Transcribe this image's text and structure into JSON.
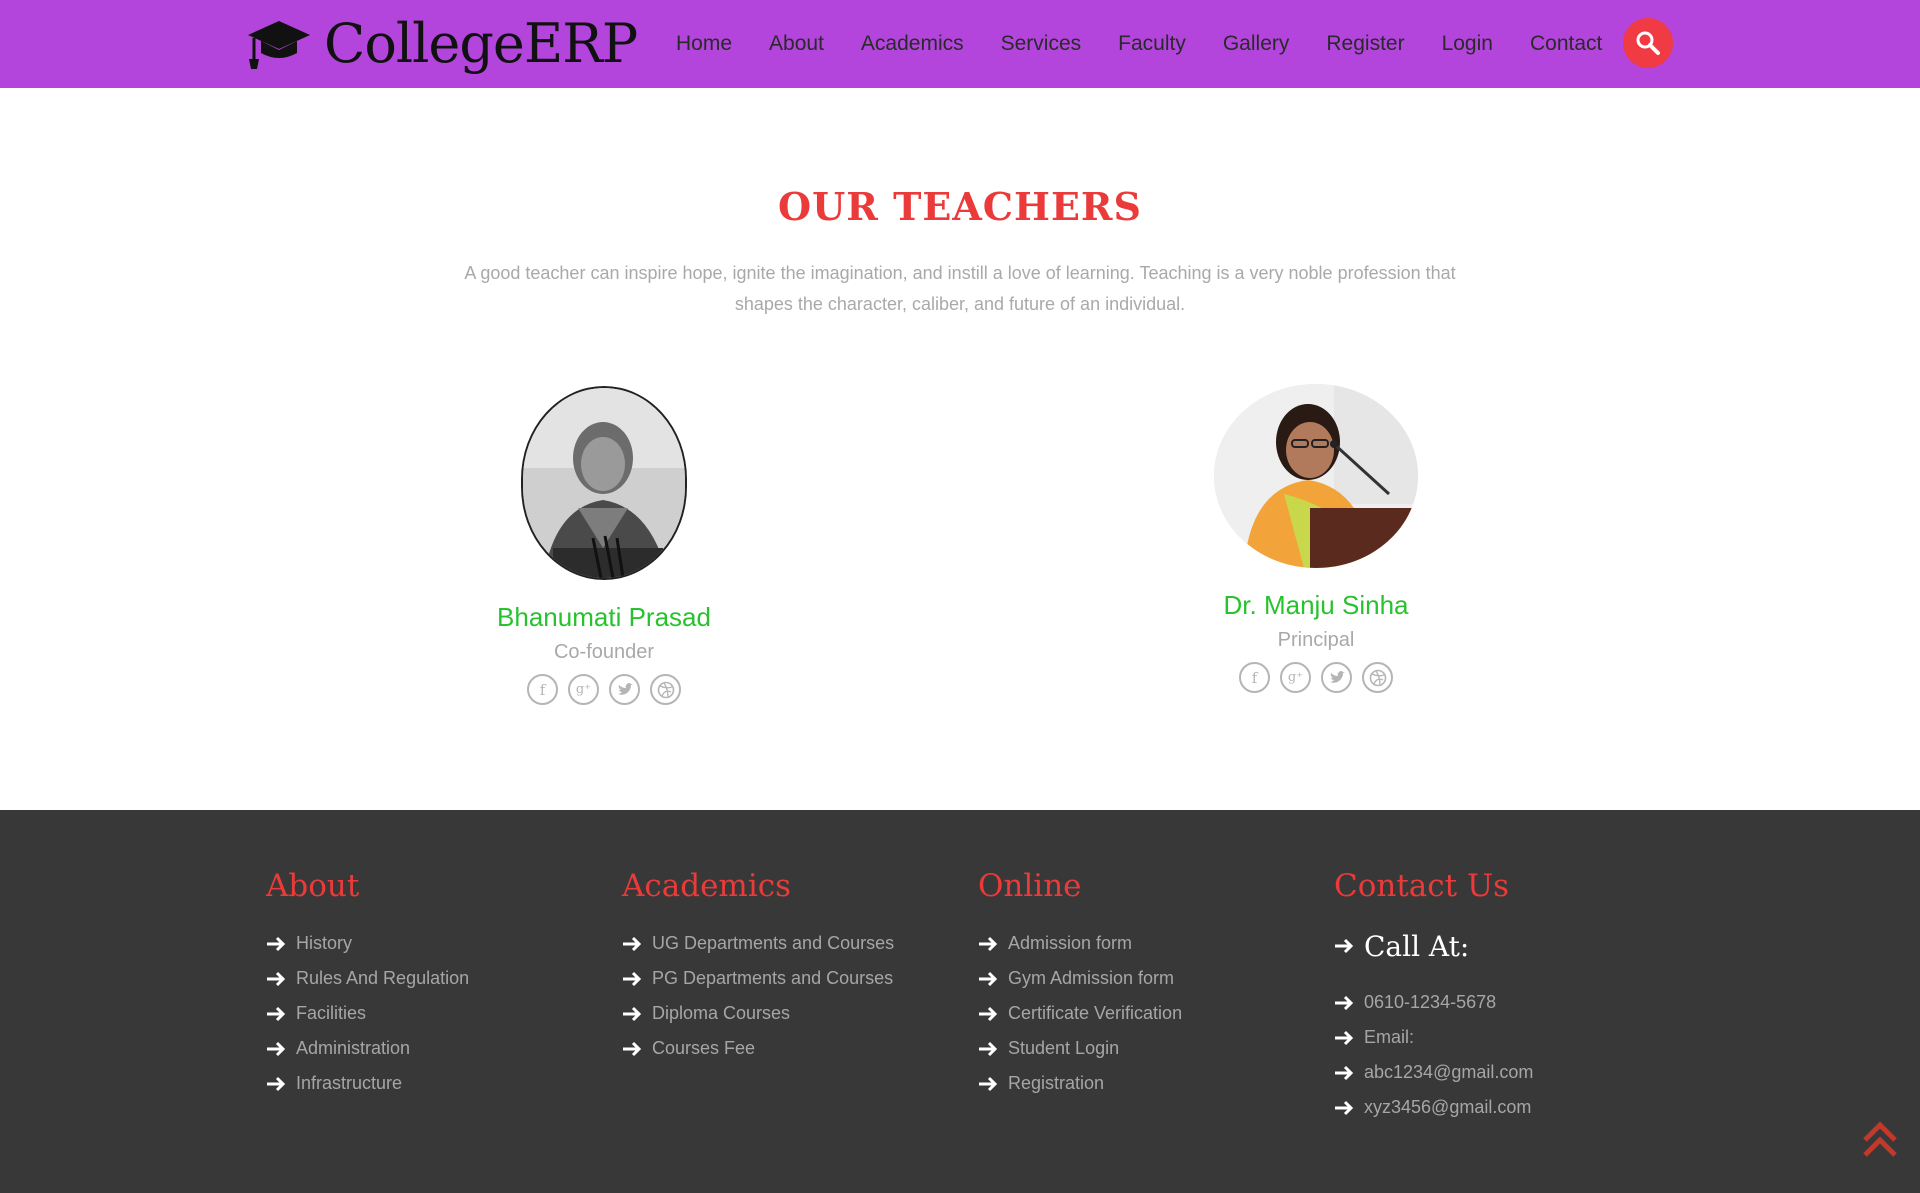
{
  "brand": {
    "name": "CollegeERP"
  },
  "nav": {
    "items": [
      {
        "label": "Home"
      },
      {
        "label": "About"
      },
      {
        "label": "Academics"
      },
      {
        "label": "Services"
      },
      {
        "label": "Faculty"
      },
      {
        "label": "Gallery"
      },
      {
        "label": "Register"
      },
      {
        "label": "Login"
      },
      {
        "label": "Contact"
      }
    ],
    "search_icon": "search-icon"
  },
  "teachers_section": {
    "title": "OUR TEACHERS",
    "description": "A good teacher can inspire hope, ignite the imagination, and instill a love of learning. Teaching is a very noble profession that shapes the character, caliber, and future of an individual.",
    "teachers": [
      {
        "name": "Bhanumati Prasad",
        "role": "Co-founder",
        "socials": [
          "facebook-icon",
          "google-plus-icon",
          "twitter-icon",
          "dribbble-icon"
        ]
      },
      {
        "name": "Dr. Manju Sinha",
        "role": "Principal",
        "socials": [
          "facebook-icon",
          "google-plus-icon",
          "twitter-icon",
          "dribbble-icon"
        ]
      }
    ]
  },
  "footer": {
    "about": {
      "heading": "About",
      "links": [
        "History",
        "Rules And Regulation",
        "Facilities",
        "Administration",
        "Infrastructure"
      ]
    },
    "academics": {
      "heading": "Academics",
      "links": [
        "UG Departments and Courses",
        "PG Departments and Courses",
        "Diploma Courses",
        "Courses Fee"
      ]
    },
    "online": {
      "heading": "Online",
      "links": [
        "Admission form",
        "Gym Admission form",
        "Certificate Verification",
        "Student Login",
        "Registration"
      ]
    },
    "contact": {
      "heading": "Contact Us",
      "call_at": "Call At:",
      "phone": "0610-1234-5678",
      "email_label": "Email:",
      "emails": [
        "abc1234@gmail.com",
        "xyz3456@gmail.com"
      ]
    }
  },
  "colors": {
    "header_bg": "#b345dc",
    "accent_red": "#ea3a3a",
    "teacher_name": "#29c22f",
    "footer_bg": "#383838"
  },
  "scroll_top_icon": "double-chevron-up-icon"
}
